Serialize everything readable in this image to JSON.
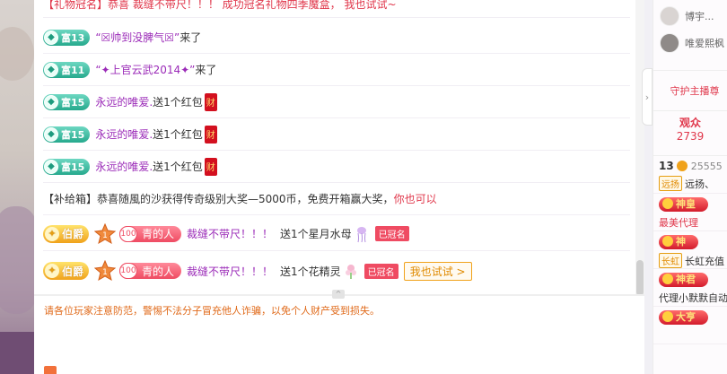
{
  "chat": {
    "gift_crown": {
      "tag": "【礼物冠名】",
      "text": "恭喜 裁缝不带尺！！！ 成功冠名礼物四季魔盒， 我也试试~"
    },
    "entries": [
      {
        "wealth": "富13",
        "name": "“☒帅到没脾气☒”",
        "suffix": "来了"
      },
      {
        "wealth": "富11",
        "name": "“✦上官云武2014✦”",
        "suffix": "来了"
      }
    ],
    "hongbao": [
      {
        "wealth": "富15",
        "user": "永远的唯爱.",
        "action": "送1个红包",
        "icon_text": "财"
      },
      {
        "wealth": "富15",
        "user": "永远的唯爱.",
        "action": "送1个红包",
        "icon_text": "财"
      },
      {
        "wealth": "富15",
        "user": "永远的唯爱.",
        "action": "送1个红包",
        "icon_text": "财"
      }
    ],
    "supply_box": {
      "tag": "【补给箱】",
      "text": "恭喜随風的沙获得传奇级别大奖—5000币，免费开箱赢大奖，",
      "link": "你也可以"
    },
    "gifts": [
      {
        "noble": "伯爵",
        "level": "1",
        "fan_level": "100",
        "fan_name": "青的人",
        "user": "裁缝不带尺！！！",
        "action": "送1个星月水母",
        "crowned": "已冠名",
        "try": ""
      },
      {
        "noble": "伯爵",
        "level": "1",
        "fan_level": "100",
        "fan_name": "青的人",
        "user": "裁缝不带尺！！！",
        "action": "送1个花精灵",
        "crowned": "已冠名",
        "try": "我也试试 >"
      }
    ],
    "notice": "请各位玩家注意防范，警惕不法分子冒充他人诈骗，以免个人财产受到损失。",
    "collapse_glyph": "^"
  },
  "right": {
    "guards": [
      {
        "name": "博宇..."
      },
      {
        "name": "唯爱熙枫"
      }
    ],
    "guard_link": "守护主播尊",
    "audience_label": "观众",
    "audience_count": "2739",
    "expand_glyph": "›",
    "viewers": [
      {
        "level": "13",
        "id": "25555",
        "tag": "远扬",
        "name": "远扬、"
      },
      {
        "badge": "神皇",
        "name": "最美代理",
        "name_color": "red"
      },
      {
        "badge": "神",
        "tag": "长虹",
        "name": "长虹充值"
      },
      {
        "badge": "神君",
        "name": "代理小默默自动"
      },
      {
        "badge": "大亨",
        "name": ""
      }
    ]
  },
  "colors": {
    "accent_red": "#e0374b",
    "purple_name": "#9b2bb8",
    "notice_orange": "#e06a1a",
    "wealth_green": "#26a98d",
    "noble_gold": "#f0a21b"
  }
}
